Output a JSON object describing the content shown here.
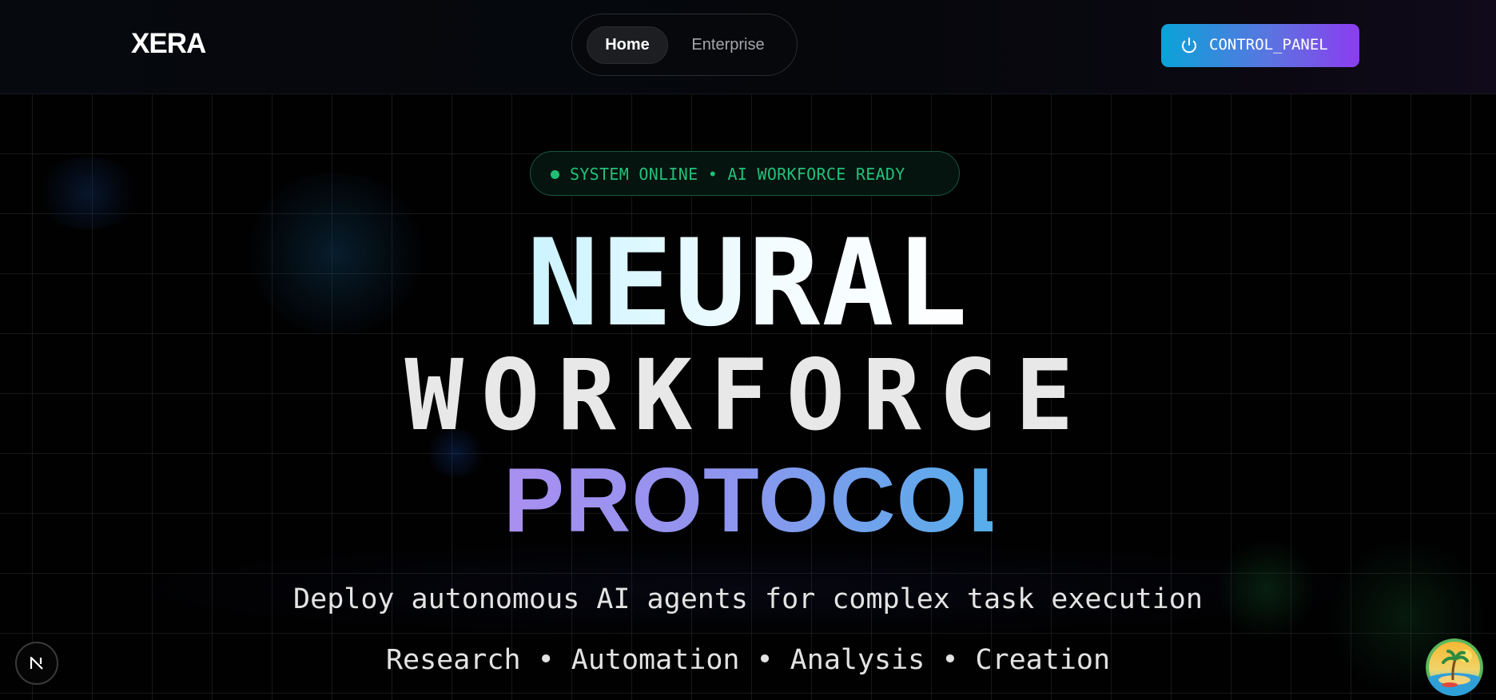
{
  "header": {
    "logo": "XERA",
    "nav": {
      "home_label": "Home",
      "enterprise_label": "Enterprise"
    },
    "control_panel_label": "CONTROL_PANEL",
    "control_panel_icon": "power-icon"
  },
  "hero": {
    "status_text": "SYSTEM ONLINE • AI WORKFORCE READY",
    "title_line1": "NEURAL",
    "title_line2": "WORKFORCE",
    "title_line3": "PROTOCOL",
    "subtitle": "Deploy autonomous AI agents for complex task execution",
    "capabilities": "Research • Automation • Analysis • Creation"
  },
  "overlays": {
    "left_badge_icon": "nextjs-n-icon",
    "right_badge_icon": "beach-island-icon"
  },
  "colors": {
    "background": "#000000",
    "status_green": "#22c07a",
    "button_gradient_start": "#0aa3d8",
    "button_gradient_end": "#8c3df0",
    "protocol_gradient_start": "#a98ff0",
    "protocol_gradient_end": "#56aeea"
  }
}
